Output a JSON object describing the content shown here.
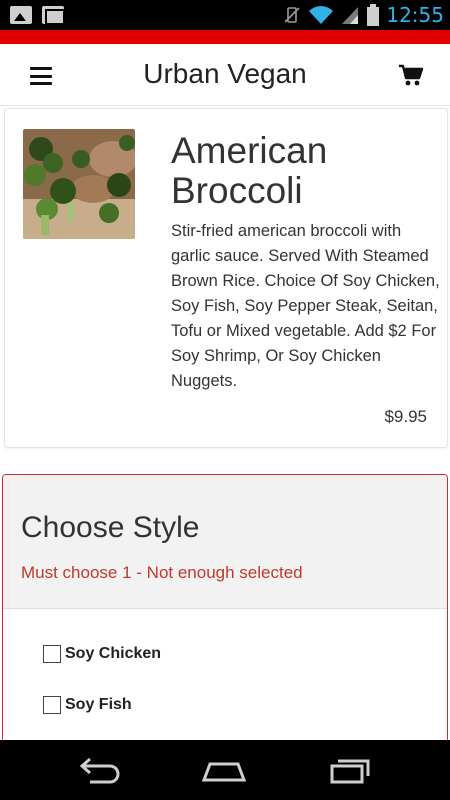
{
  "status_bar": {
    "time": "12:55",
    "left_icons": [
      "gallery-notification-icon",
      "gmail-notification-icon"
    ],
    "right_icons": [
      "vibrate-off-icon",
      "wifi-icon",
      "signal-icon",
      "battery-icon"
    ]
  },
  "app_bar": {
    "title": "Urban Vegan",
    "menu_icon": "hamburger-menu-icon",
    "cart_icon": "shopping-cart-icon"
  },
  "dish": {
    "name": "American Broccoli",
    "description": "Stir-fried american broccoli with garlic sauce. Served With Steamed Brown Rice. Choice Of Soy Chicken, Soy Fish, Soy Pepper Steak, Seitan, Tofu or Mixed vegetable. Add $2 For Soy Shrimp, Or Soy Chicken Nuggets.",
    "price": "$9.95"
  },
  "style_section": {
    "title": "Choose Style",
    "validation_message": "Must choose 1 - Not enough selected",
    "options": [
      {
        "label": "Soy Chicken",
        "checked": false
      },
      {
        "label": "Soy Fish",
        "checked": false
      }
    ]
  },
  "colors": {
    "accent_red": "#e10000",
    "error_red": "#c0392b",
    "status_time_blue": "#2fb3e6"
  },
  "nav_bar": {
    "buttons": [
      "back-icon",
      "home-icon",
      "recent-apps-icon"
    ]
  }
}
